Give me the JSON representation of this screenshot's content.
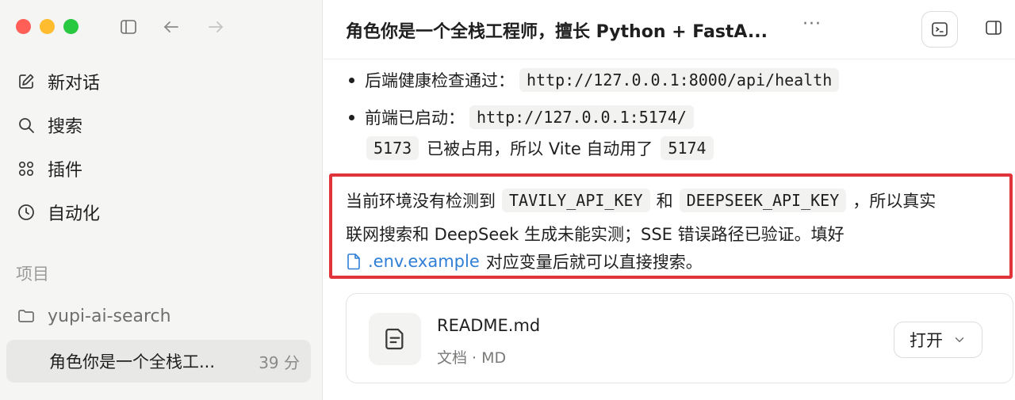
{
  "sidebar": {
    "nav": [
      {
        "label": "新对话",
        "icon": "edit-icon"
      },
      {
        "label": "搜索",
        "icon": "search-icon"
      },
      {
        "label": "插件",
        "icon": "grid-icon"
      },
      {
        "label": "自动化",
        "icon": "clock-icon"
      }
    ],
    "section_label": "项目",
    "project": {
      "label": "yupi-ai-search",
      "icon": "folder-icon"
    },
    "conversation": {
      "title": "角色你是一个全栈工...",
      "time": "39 分"
    }
  },
  "header": {
    "title": "角色你是一个全栈工程师，擅长 Python + FastA...",
    "more": "···"
  },
  "content": {
    "bullet1": {
      "text": "后端健康检查通过：",
      "code": "http://127.0.0.1:8000/api/health"
    },
    "bullet2": {
      "text": "前端已启动：",
      "code": "http://127.0.0.1:5174/"
    },
    "line2": {
      "code1": "5173",
      "text": "已被占用，所以 Vite 自动用了",
      "code2": "5174"
    },
    "para1": {
      "t1": "当前环境没有检测到",
      "code1": "TAVILY_API_KEY",
      "t2": "和",
      "code2": "DEEPSEEK_API_KEY",
      "t3": "，所以真实"
    },
    "para2": "联网搜索和 DeepSeek 生成未能实测；SSE 错误路径已验证。填好",
    "para3": {
      "link": ".env.example",
      "text": "对应变量后就可以直接搜索。"
    },
    "card": {
      "name": "README.md",
      "meta": "文档 · MD",
      "open_label": "打开"
    }
  },
  "colors": {
    "highlight_border": "#e0343a",
    "link": "#2f7fd6"
  }
}
